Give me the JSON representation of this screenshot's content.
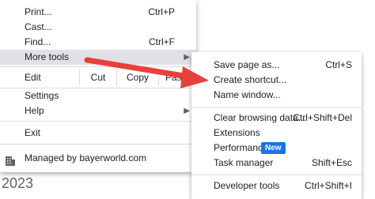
{
  "background_text": "2023",
  "main_menu": {
    "print": {
      "label": "Print...",
      "shortcut": "Ctrl+P"
    },
    "cast": {
      "label": "Cast..."
    },
    "find": {
      "label": "Find...",
      "shortcut": "Ctrl+F"
    },
    "more_tools": {
      "label": "More tools"
    },
    "edit": {
      "label": "Edit",
      "cut": "Cut",
      "copy": "Copy",
      "paste": "Paste"
    },
    "settings": {
      "label": "Settings"
    },
    "help": {
      "label": "Help"
    },
    "exit": {
      "label": "Exit"
    },
    "managed": {
      "label": "Managed by bayerworld.com"
    }
  },
  "sub_menu": {
    "save_page": {
      "label": "Save page as...",
      "shortcut": "Ctrl+S"
    },
    "create_shortcut": {
      "label": "Create shortcut..."
    },
    "name_window": {
      "label": "Name window..."
    },
    "clear_browsing": {
      "label": "Clear browsing data...",
      "shortcut": "Ctrl+Shift+Del"
    },
    "extensions": {
      "label": "Extensions"
    },
    "performance": {
      "label": "Performance",
      "badge": "New"
    },
    "task_manager": {
      "label": "Task manager",
      "shortcut": "Shift+Esc"
    },
    "developer_tools": {
      "label": "Developer tools",
      "shortcut": "Ctrl+Shift+I"
    }
  },
  "colors": {
    "annotation_arrow": "#e8413c",
    "badge": "#1a73e8",
    "highlight": "#dfe1e5"
  }
}
